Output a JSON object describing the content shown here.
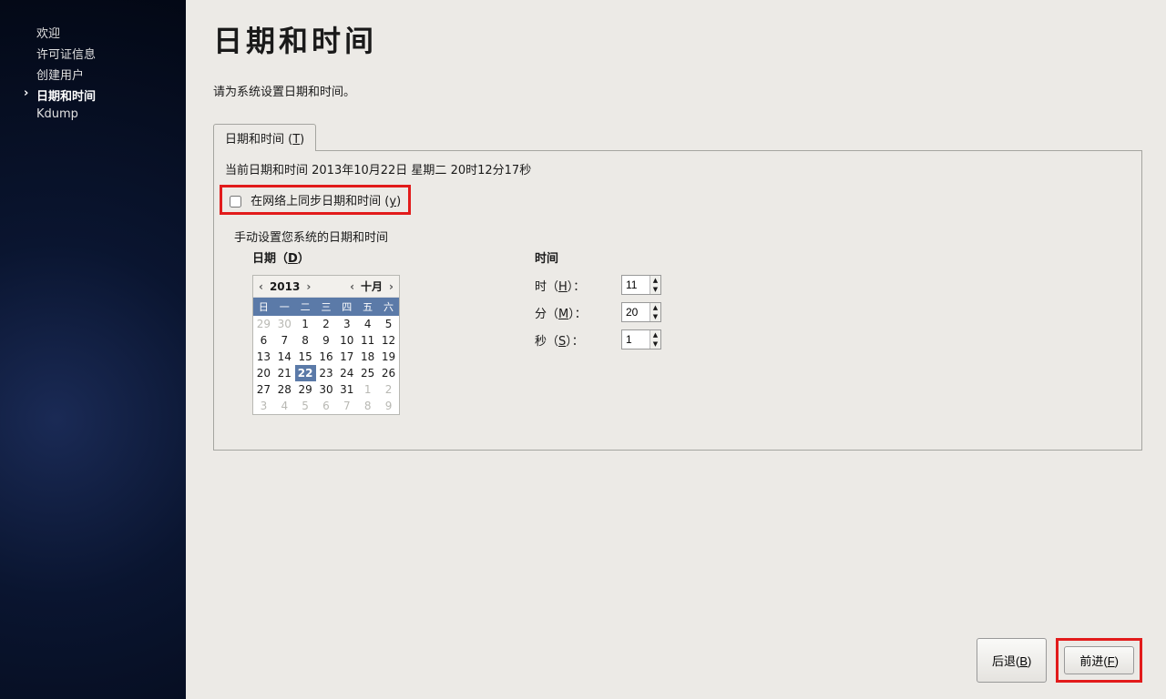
{
  "sidebar": {
    "items": [
      {
        "label": "欢迎"
      },
      {
        "label": "许可证信息"
      },
      {
        "label": "创建用户"
      },
      {
        "label": "日期和时间"
      },
      {
        "label": "Kdump"
      }
    ],
    "active_index": 3
  },
  "page": {
    "title": "日期和时间",
    "subtitle": "请为系统设置日期和时间。"
  },
  "tab": {
    "label_prefix": "日期和时间 (",
    "label_key": "T",
    "label_suffix": ")"
  },
  "network_time": "当前日期和时间   2013年10月22日   星期二   20时12分17秒",
  "sync_checkbox": {
    "prefix": "在网络上同步日期和时间 (",
    "key": "y",
    "suffix": ")",
    "checked": false
  },
  "manual_label": "手动设置您系统的日期和时间",
  "date_section": {
    "heading_prefix": "日期（",
    "heading_key": "D",
    "heading_suffix": "）",
    "year": "2013",
    "month": "十月",
    "weekdays": [
      "日",
      "一",
      "二",
      "三",
      "四",
      "五",
      "六"
    ],
    "grid": [
      [
        {
          "d": "29",
          "dim": true
        },
        {
          "d": "30",
          "dim": true
        },
        {
          "d": "1"
        },
        {
          "d": "2"
        },
        {
          "d": "3"
        },
        {
          "d": "4"
        },
        {
          "d": "5"
        }
      ],
      [
        {
          "d": "6"
        },
        {
          "d": "7"
        },
        {
          "d": "8"
        },
        {
          "d": "9"
        },
        {
          "d": "10"
        },
        {
          "d": "11"
        },
        {
          "d": "12"
        }
      ],
      [
        {
          "d": "13"
        },
        {
          "d": "14"
        },
        {
          "d": "15"
        },
        {
          "d": "16"
        },
        {
          "d": "17"
        },
        {
          "d": "18"
        },
        {
          "d": "19"
        }
      ],
      [
        {
          "d": "20"
        },
        {
          "d": "21"
        },
        {
          "d": "22",
          "sel": true
        },
        {
          "d": "23"
        },
        {
          "d": "24"
        },
        {
          "d": "25"
        },
        {
          "d": "26"
        }
      ],
      [
        {
          "d": "27"
        },
        {
          "d": "28"
        },
        {
          "d": "29"
        },
        {
          "d": "30"
        },
        {
          "d": "31"
        },
        {
          "d": "1",
          "dim": true
        },
        {
          "d": "2",
          "dim": true
        }
      ],
      [
        {
          "d": "3",
          "dim": true
        },
        {
          "d": "4",
          "dim": true
        },
        {
          "d": "5",
          "dim": true
        },
        {
          "d": "6",
          "dim": true
        },
        {
          "d": "7",
          "dim": true
        },
        {
          "d": "8",
          "dim": true
        },
        {
          "d": "9",
          "dim": true
        }
      ]
    ]
  },
  "time_section": {
    "heading": "时间",
    "rows": [
      {
        "label_prefix": "时（",
        "key": "H",
        "label_suffix": "）：",
        "value": "11"
      },
      {
        "label_prefix": "分（",
        "key": "M",
        "label_suffix": "）：",
        "value": "20"
      },
      {
        "label_prefix": "秒（",
        "key": "S",
        "label_suffix": "）：",
        "value": "1"
      }
    ]
  },
  "footer": {
    "back_prefix": "后退(",
    "back_key": "B",
    "back_suffix": ")",
    "forward_prefix": "前进(",
    "forward_key": "F",
    "forward_suffix": ")"
  }
}
